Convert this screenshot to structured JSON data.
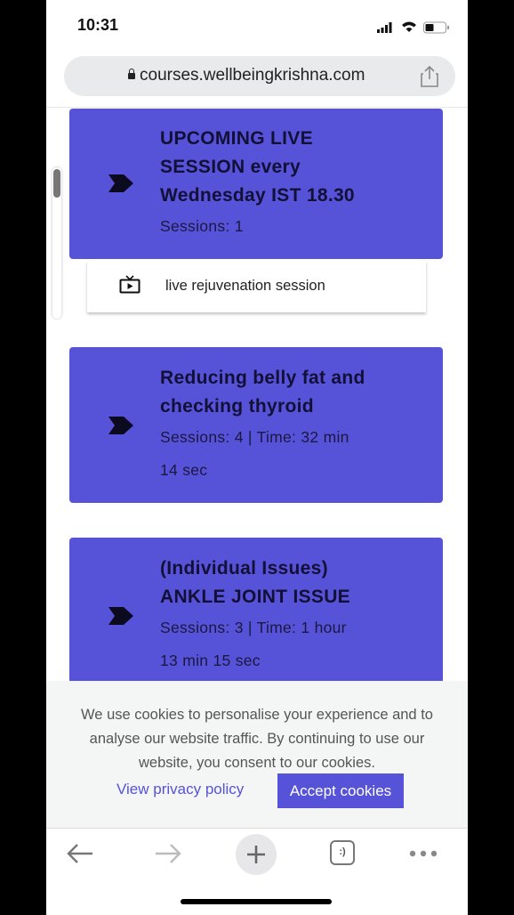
{
  "status_bar": {
    "time": "10:31"
  },
  "browser": {
    "url": "courses.wellbeingkrishna.com",
    "toolbar": {
      "back": "back-arrow",
      "forward": "forward-arrow",
      "new_tab": "plus",
      "tabs_label": ":)",
      "more": "more"
    }
  },
  "sections": [
    {
      "title_lines": [
        "UPCOMING LIVE",
        "SESSION every",
        "Wednesday IST 18.30"
      ],
      "meta_lines": [
        "Sessions: 1"
      ],
      "lessons": [
        {
          "title": "live rejuvenation session",
          "icon": "tv-play-icon"
        }
      ]
    },
    {
      "title_lines": [
        "Reducing belly fat and",
        "checking thyroid"
      ],
      "meta_lines": [
        "Sessions: 4 | Time: 32 min",
        "14 sec"
      ]
    },
    {
      "title_lines": [
        "(Individual Issues)",
        "ANKLE JOINT ISSUE"
      ],
      "meta_lines": [
        "Sessions: 3 | Time: 1 hour",
        "13 min 15 sec"
      ]
    }
  ],
  "cookie_banner": {
    "text": "We use cookies to personalise your experience and to analyse our website traffic. By continuing to use our website, you consent to our cookies.",
    "privacy_link": "View privacy policy",
    "accept_button": "Accept cookies"
  },
  "colors": {
    "accent": "#5753d8",
    "banner_bg": "#f4f5f5"
  }
}
